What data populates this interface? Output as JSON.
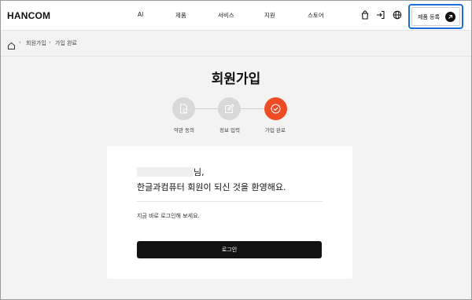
{
  "header": {
    "logo": "HANCOM",
    "nav": [
      "AI",
      "제품",
      "서비스",
      "지원",
      "스토어"
    ],
    "icons": [
      "shopping-bag-icon",
      "login-icon",
      "globe-icon"
    ],
    "register_label": "제품 등록",
    "register_icon": "arrow-up-right-icon"
  },
  "breadcrumb": {
    "home_icon": "home-icon",
    "items": [
      "회원가입",
      "가입 완료"
    ]
  },
  "page": {
    "title": "회원가입",
    "steps": [
      {
        "label": "약관 동의",
        "icon": "document-check-icon",
        "state": "done"
      },
      {
        "label": "정보 입력",
        "icon": "edit-icon",
        "state": "done"
      },
      {
        "label": "가입 완료",
        "icon": "check-icon",
        "state": "active"
      }
    ]
  },
  "card": {
    "greeting_suffix": "님,",
    "welcome": "한글과컴퓨터 회원이 되신 것을 환영해요.",
    "hint": "지금 바로 로그인해 보세요.",
    "login_label": "로그인"
  },
  "colors": {
    "accent": "#ef4b25",
    "focus_outline": "#1d6fd8",
    "button_dark": "#111111",
    "step_inactive": "#d8d8d8",
    "background": "#f3f3f3"
  }
}
